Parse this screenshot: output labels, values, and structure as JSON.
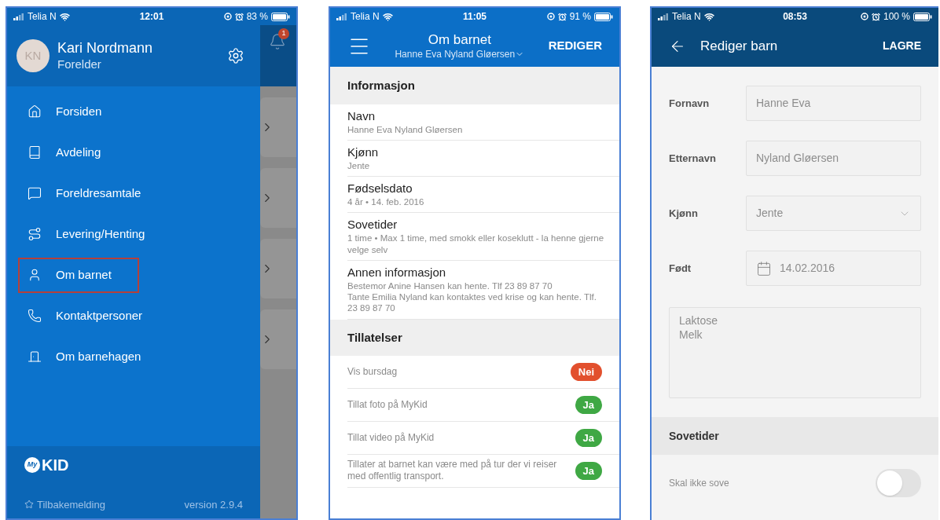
{
  "menu_screen": {
    "status_bar": {
      "carrier": "Telia N",
      "time": "12:01",
      "battery": "83 %"
    },
    "profile": {
      "initials": "KN",
      "name": "Kari Nordmann",
      "role": "Forelder"
    },
    "notification_badge": "1",
    "menu_items": [
      {
        "label": "Forsiden",
        "selected": false
      },
      {
        "label": "Avdeling",
        "selected": false
      },
      {
        "label": "Foreldresamtale",
        "selected": false
      },
      {
        "label": "Levering/Henting",
        "selected": false
      },
      {
        "label": "Om barnet",
        "selected": true
      },
      {
        "label": "Kontaktpersoner",
        "selected": false
      },
      {
        "label": "Om barnehagen",
        "selected": false
      }
    ],
    "footer": {
      "logo_badge": "My",
      "logo_text": "KID",
      "feedback": "Tilbakemelding",
      "version": "version 2.9.4"
    }
  },
  "child_screen": {
    "status_bar": {
      "carrier": "Telia N",
      "time": "11:05",
      "battery": "91 %"
    },
    "title": "Om barnet",
    "subtitle": "Hanne Eva Nyland Gløersen",
    "action": "REDIGER",
    "info_section": {
      "heading": "Informasjon",
      "rows": [
        {
          "label": "Navn",
          "value": "Hanne Eva Nyland Gløersen"
        },
        {
          "label": "Kjønn",
          "value": "Jente"
        },
        {
          "label": "Fødselsdato",
          "value": "4 år • 14. feb. 2016"
        },
        {
          "label": "Sovetider",
          "value": "1 time • Max 1 time, med smokk eller koseklutt - la henne gjerne velge selv"
        },
        {
          "label": "Annen informasjon",
          "value": "Bestemor Anine Hansen kan hente. Tlf 23 89 87 70\nTante Emilia Nyland kan kontaktes ved krise og kan hente. Tlf. 23 89 87 70"
        }
      ]
    },
    "permissions_section": {
      "heading": "Tillatelser",
      "rows": [
        {
          "label": "Vis bursdag",
          "answer": "Nei",
          "on": false
        },
        {
          "label": "Tillat foto på MyKid",
          "answer": "Ja",
          "on": true
        },
        {
          "label": "Tillat video på MyKid",
          "answer": "Ja",
          "on": true
        },
        {
          "label": "Tillater at barnet kan være med på tur der vi reiser med offentlig transport.",
          "answer": "Ja",
          "on": true
        }
      ]
    }
  },
  "edit_screen": {
    "status_bar": {
      "carrier": "Telia N",
      "time": "08:53",
      "battery": "100 %"
    },
    "title": "Rediger barn",
    "action": "LAGRE",
    "fields": [
      {
        "kind": "text",
        "label": "Fornavn",
        "value": "Hanne Eva"
      },
      {
        "kind": "text",
        "label": "Etternavn",
        "value": "Nyland Gløersen"
      },
      {
        "kind": "select",
        "label": "Kjønn",
        "value": "Jente"
      },
      {
        "kind": "date",
        "label": "Født",
        "value": "14.02.2016"
      },
      {
        "kind": "textarea",
        "value": "Laktose\nMelk"
      }
    ],
    "section_heading": "Sovetider",
    "toggle": {
      "label": "Skal ikke sove",
      "on": false
    }
  }
}
